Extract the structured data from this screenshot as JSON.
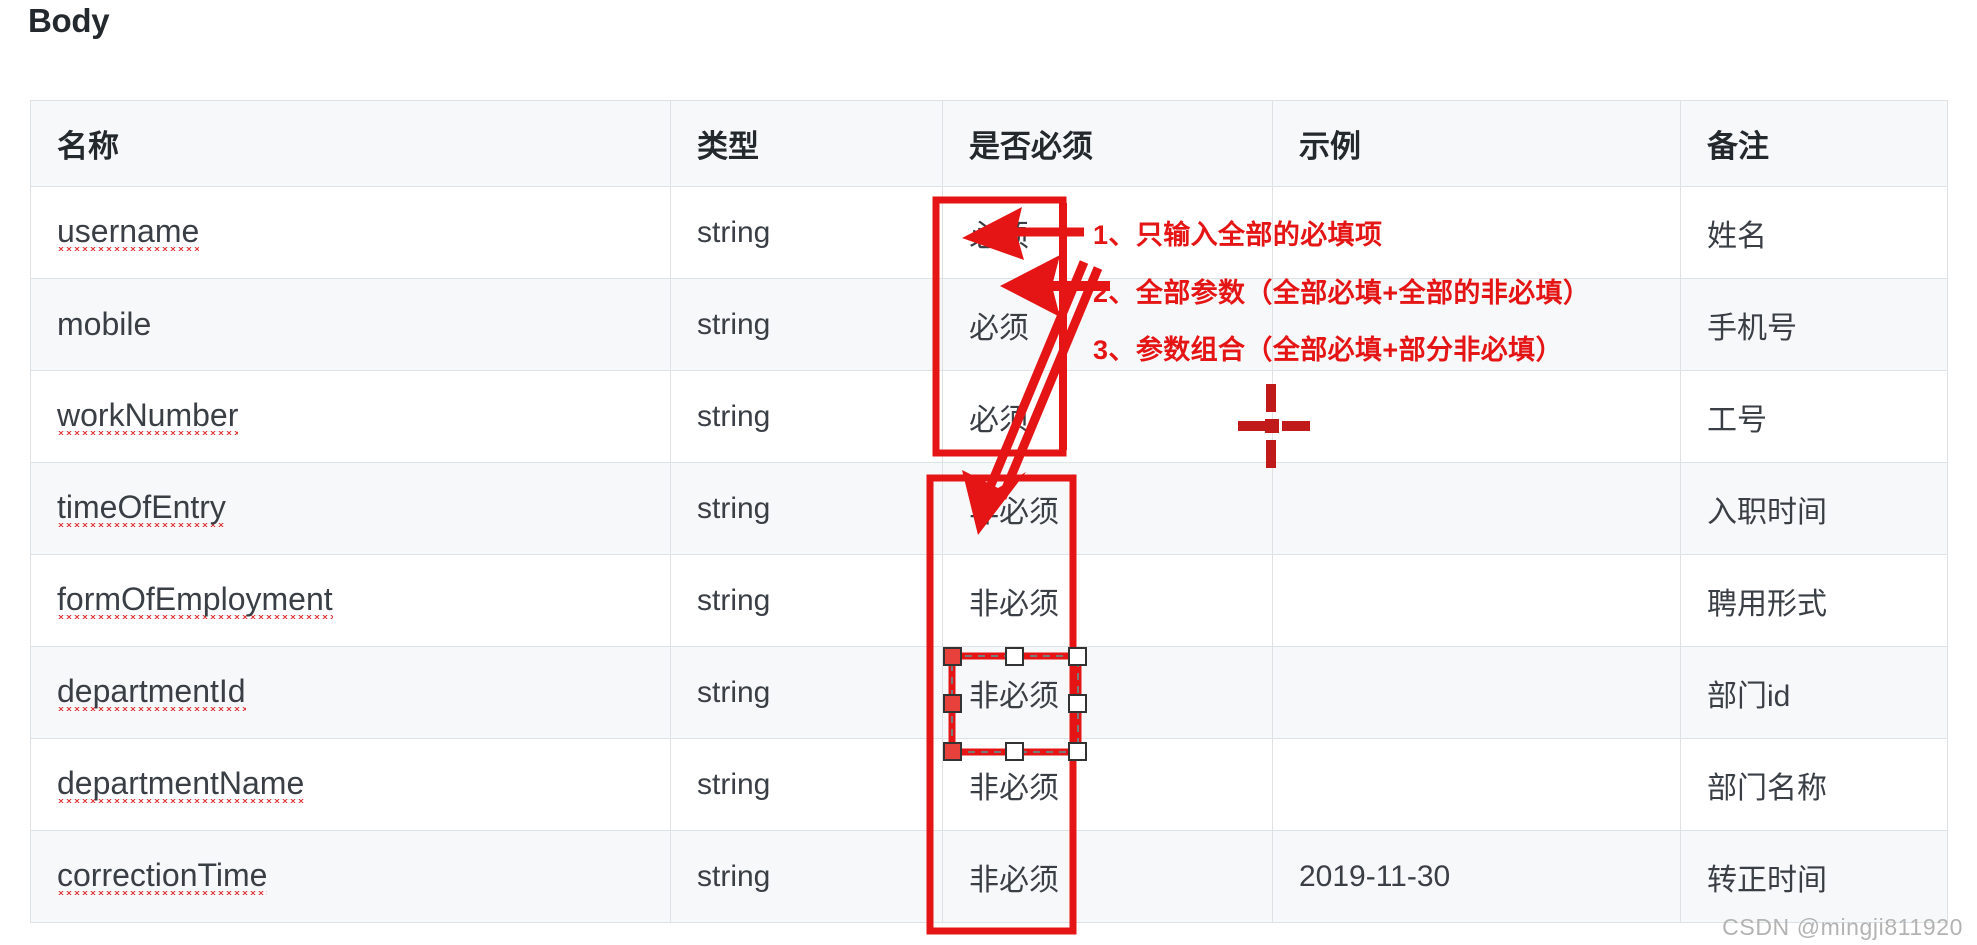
{
  "page": {
    "title": "Body",
    "watermark": "CSDN @mingji811920"
  },
  "table": {
    "columns": [
      {
        "key": "name",
        "label": "名称"
      },
      {
        "key": "type",
        "label": "类型"
      },
      {
        "key": "required",
        "label": "是否必须"
      },
      {
        "key": "example",
        "label": "示例"
      },
      {
        "key": "remark",
        "label": "备注"
      }
    ],
    "rows": [
      {
        "name": "username",
        "misspelled": true,
        "type": "string",
        "required": "必须",
        "example": "",
        "remark": "姓名"
      },
      {
        "name": "mobile",
        "misspelled": false,
        "type": "string",
        "required": "必须",
        "example": "",
        "remark": "手机号"
      },
      {
        "name": "workNumber",
        "misspelled": true,
        "type": "string",
        "required": "必须",
        "example": "",
        "remark": "工号"
      },
      {
        "name": "timeOfEntry",
        "misspelled": true,
        "type": "string",
        "required": "非必须",
        "example": "",
        "remark": "入职时间"
      },
      {
        "name": "formOfEmployment",
        "misspelled": true,
        "type": "string",
        "required": "非必须",
        "example": "",
        "remark": "聘用形式"
      },
      {
        "name": "departmentId",
        "misspelled": true,
        "type": "string",
        "required": "非必须",
        "example": "",
        "remark": "部门id"
      },
      {
        "name": "departmentName",
        "misspelled": true,
        "type": "string",
        "required": "非必须",
        "example": "",
        "remark": "部门名称"
      },
      {
        "name": "correctionTime",
        "misspelled": true,
        "type": "string",
        "required": "非必须",
        "example": "2019-11-30",
        "remark": "转正时间"
      }
    ]
  },
  "annotations": {
    "color": "#e51515",
    "notes": [
      {
        "id": 1,
        "text": "1、只输入全部的必填项"
      },
      {
        "id": 2,
        "text": "2、全部参数（全部必填+全部的非必填）"
      },
      {
        "id": 3,
        "text": "3、参数组合（全部必填+部分非必填）"
      }
    ],
    "shapes": {
      "required_box_label": "红色方框-必须项",
      "optional_box_label": "红色方框-非必须项",
      "selected_shape_label": "departmentId-非必须-选中框",
      "crosshair_label": "红色十字标记"
    }
  }
}
